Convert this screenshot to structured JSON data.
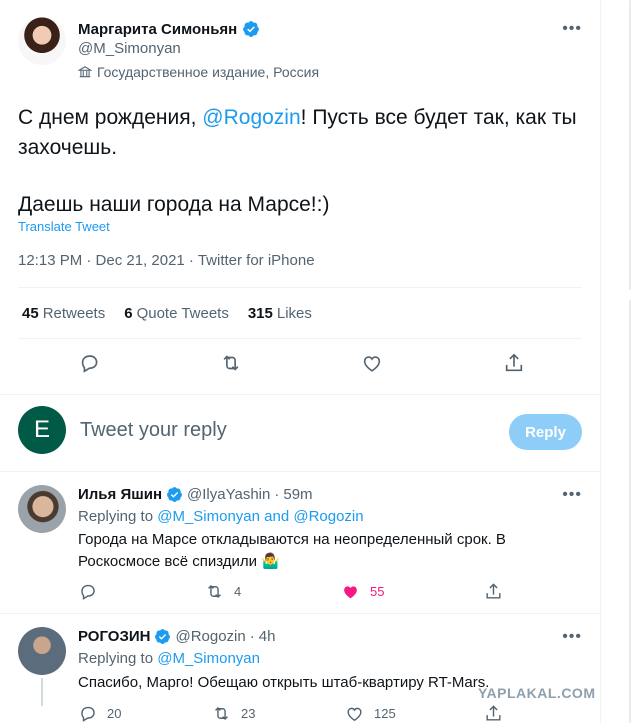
{
  "tweet": {
    "author_name": "Маргарита Симоньян",
    "author_handle": "@M_Simonyan",
    "label": "Государственное издание, Россия",
    "text_before": "С днем рождения, ",
    "mention": "@Rogozin",
    "text_after": "! Пусть все будет так, как ты захочешь.",
    "text_line2": "Даешь наши города на Марсе!:)",
    "translate_label": "Translate Tweet",
    "meta": "12:13 PM · Dec 21, 2021 · Twitter for iPhone",
    "stats": [
      {
        "count": "45",
        "label": "Retweets"
      },
      {
        "count": "6",
        "label": "Quote Tweets"
      },
      {
        "count": "315",
        "label": "Likes"
      }
    ]
  },
  "reply_box": {
    "avatar_letter": "E",
    "placeholder": "Tweet your reply",
    "button_label": "Reply"
  },
  "replies": [
    {
      "name": "Илья Яшин",
      "handle": "@IlyaYashin",
      "time": "59m",
      "replying_prefix": "Replying to ",
      "replying_to": "@M_Simonyan and @Rogozin",
      "text": "Города на Марсе откладываются на неопределенный срок. В Роскосмосе всё спиздили 🤷‍♂️",
      "retweets": "4",
      "likes": "55",
      "liked": true
    },
    {
      "name": "РОГОЗИН",
      "handle": "@Rogozin",
      "time": "4h",
      "replying_prefix": "Replying to ",
      "replying_to": "@M_Simonyan",
      "text": "Спасибо, Марго! Обещаю открыть штаб-квартиру RT-Mars.",
      "replies": "20",
      "retweets": "23",
      "likes": "125"
    }
  ],
  "watermark": "YAPLAKAL.COM",
  "colors": {
    "accent": "#1d9bf0",
    "like": "#f91880",
    "reply_button_disabled": "#8ecdf7",
    "muted_text": "#536471"
  },
  "icons": [
    "verified-badge-icon",
    "state-media-icon",
    "more-icon",
    "reply-icon",
    "retweet-icon",
    "like-icon",
    "share-icon"
  ]
}
